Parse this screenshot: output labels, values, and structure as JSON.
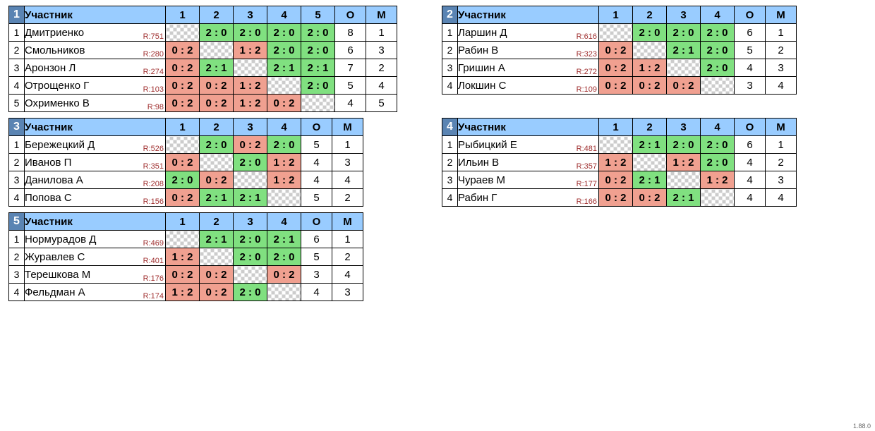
{
  "version": "1.88.0",
  "columns": {
    "participant": "Участник",
    "o": "О",
    "m": "М"
  },
  "groups": [
    {
      "num": 1,
      "size": 5,
      "rows": [
        {
          "name": "Дмитриенко",
          "cut": true,
          "rating": "R:751",
          "cells": [
            null,
            "2 : 0",
            "2 : 0",
            "2 : 0",
            "2 : 0"
          ],
          "o": 8,
          "m": 1
        },
        {
          "name": "Смольников",
          "cut": true,
          "rating": "R:280",
          "cells": [
            "0 : 2",
            null,
            "1 : 2",
            "2 : 0",
            "2 : 0"
          ],
          "o": 6,
          "m": 3
        },
        {
          "name": "Аронзон Л",
          "cut": false,
          "rating": "R:274",
          "cells": [
            "0 : 2",
            "2 : 1",
            null,
            "2 : 1",
            "2 : 1"
          ],
          "o": 7,
          "m": 2
        },
        {
          "name": "Отрощенко Г",
          "cut": true,
          "rating": "R:103",
          "cells": [
            "0 : 2",
            "0 : 2",
            "1 : 2",
            null,
            "2 : 0"
          ],
          "o": 5,
          "m": 4
        },
        {
          "name": "Охрименко В",
          "cut": false,
          "rating": "R:98",
          "cells": [
            "0 : 2",
            "0 : 2",
            "1 : 2",
            "0 : 2",
            null
          ],
          "o": 4,
          "m": 5
        }
      ]
    },
    {
      "num": 2,
      "size": 4,
      "rows": [
        {
          "name": "Ларшин Д",
          "cut": false,
          "rating": "R:616",
          "cells": [
            null,
            "2 : 0",
            "2 : 0",
            "2 : 0"
          ],
          "o": 6,
          "m": 1
        },
        {
          "name": "Рабин В",
          "cut": false,
          "rating": "R:323",
          "cells": [
            "0 : 2",
            null,
            "2 : 1",
            "2 : 0"
          ],
          "o": 5,
          "m": 2
        },
        {
          "name": "Гришин А",
          "cut": false,
          "rating": "R:272",
          "cells": [
            "0 : 2",
            "1 : 2",
            null,
            "2 : 0"
          ],
          "o": 4,
          "m": 3
        },
        {
          "name": "Локшин С",
          "cut": false,
          "rating": "R:109",
          "cells": [
            "0 : 2",
            "0 : 2",
            "0 : 2",
            null
          ],
          "o": 3,
          "m": 4
        }
      ]
    },
    {
      "num": 3,
      "size": 4,
      "rows": [
        {
          "name": "Бережецкий Д",
          "cut": false,
          "rating": "R:526",
          "cells": [
            null,
            "2 : 0",
            "0 : 2",
            "2 : 0"
          ],
          "o": 5,
          "m": 1
        },
        {
          "name": "Иванов П",
          "cut": false,
          "rating": "R:351",
          "cells": [
            "0 : 2",
            null,
            "2 : 0",
            "1 : 2"
          ],
          "o": 4,
          "m": 3
        },
        {
          "name": "Данилова А",
          "cut": false,
          "rating": "R:208",
          "cells": [
            "2 : 0",
            "0 : 2",
            null,
            "1 : 2"
          ],
          "o": 4,
          "m": 4
        },
        {
          "name": "Попова С",
          "cut": false,
          "rating": "R:156",
          "cells": [
            "0 : 2",
            "2 : 1",
            "2 : 1",
            null
          ],
          "o": 5,
          "m": 2
        }
      ]
    },
    {
      "num": 4,
      "size": 4,
      "rows": [
        {
          "name": "Рыбицкий Е",
          "cut": false,
          "rating": "R:481",
          "cells": [
            null,
            "2 : 1",
            "2 : 0",
            "2 : 0"
          ],
          "o": 6,
          "m": 1
        },
        {
          "name": "Ильин В",
          "cut": false,
          "rating": "R:357",
          "cells": [
            "1 : 2",
            null,
            "1 : 2",
            "2 : 0"
          ],
          "o": 4,
          "m": 2
        },
        {
          "name": "Чураев М",
          "cut": false,
          "rating": "R:177",
          "cells": [
            "0 : 2",
            "2 : 1",
            null,
            "1 : 2"
          ],
          "o": 4,
          "m": 3
        },
        {
          "name": "Рабин Г",
          "cut": false,
          "rating": "R:166",
          "cells": [
            "0 : 2",
            "0 : 2",
            "2 : 1",
            null
          ],
          "o": 4,
          "m": 4
        }
      ]
    },
    {
      "num": 5,
      "size": 4,
      "rows": [
        {
          "name": "Нормурадов Д",
          "cut": false,
          "rating": "R:469",
          "cells": [
            null,
            "2 : 1",
            "2 : 0",
            "2 : 1"
          ],
          "o": 6,
          "m": 1
        },
        {
          "name": "Журавлев С",
          "cut": false,
          "rating": "R:401",
          "cells": [
            "1 : 2",
            null,
            "2 : 0",
            "2 : 0"
          ],
          "o": 5,
          "m": 2
        },
        {
          "name": "Терешкова М",
          "cut": false,
          "rating": "R:176",
          "cells": [
            "0 : 2",
            "0 : 2",
            null,
            "0 : 2"
          ],
          "o": 3,
          "m": 4
        },
        {
          "name": "Фельдман А",
          "cut": false,
          "rating": "R:174",
          "cells": [
            "1 : 2",
            "0 : 2",
            "2 : 0",
            null
          ],
          "o": 4,
          "m": 3
        }
      ]
    }
  ]
}
